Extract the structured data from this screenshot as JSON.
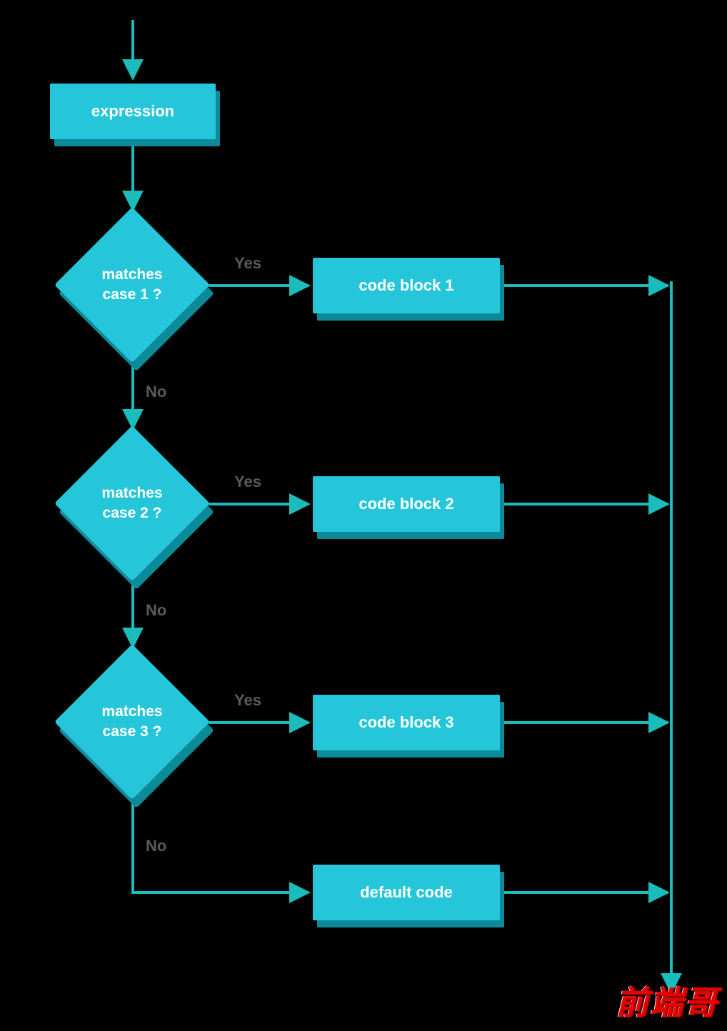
{
  "colors": {
    "node_fill": "#26c6da",
    "node_shadow": "#0d8a9a",
    "node_text": "#ffffff",
    "edge": "#1abcbc",
    "label": "#5a5a5a",
    "bg": "#000000",
    "watermark": "#e60000"
  },
  "start": {
    "label": "expression"
  },
  "decisions": [
    {
      "label": "matches\ncase 1 ?",
      "yes": "Yes",
      "no": "No",
      "target": "code block 1"
    },
    {
      "label": "matches\ncase 2 ?",
      "yes": "Yes",
      "no": "No",
      "target": "code block 2"
    },
    {
      "label": "matches\ncase 3 ?",
      "yes": "Yes",
      "no": "No",
      "target": "code block 3"
    }
  ],
  "default_block": {
    "label": "default code"
  },
  "watermark": "前端哥"
}
